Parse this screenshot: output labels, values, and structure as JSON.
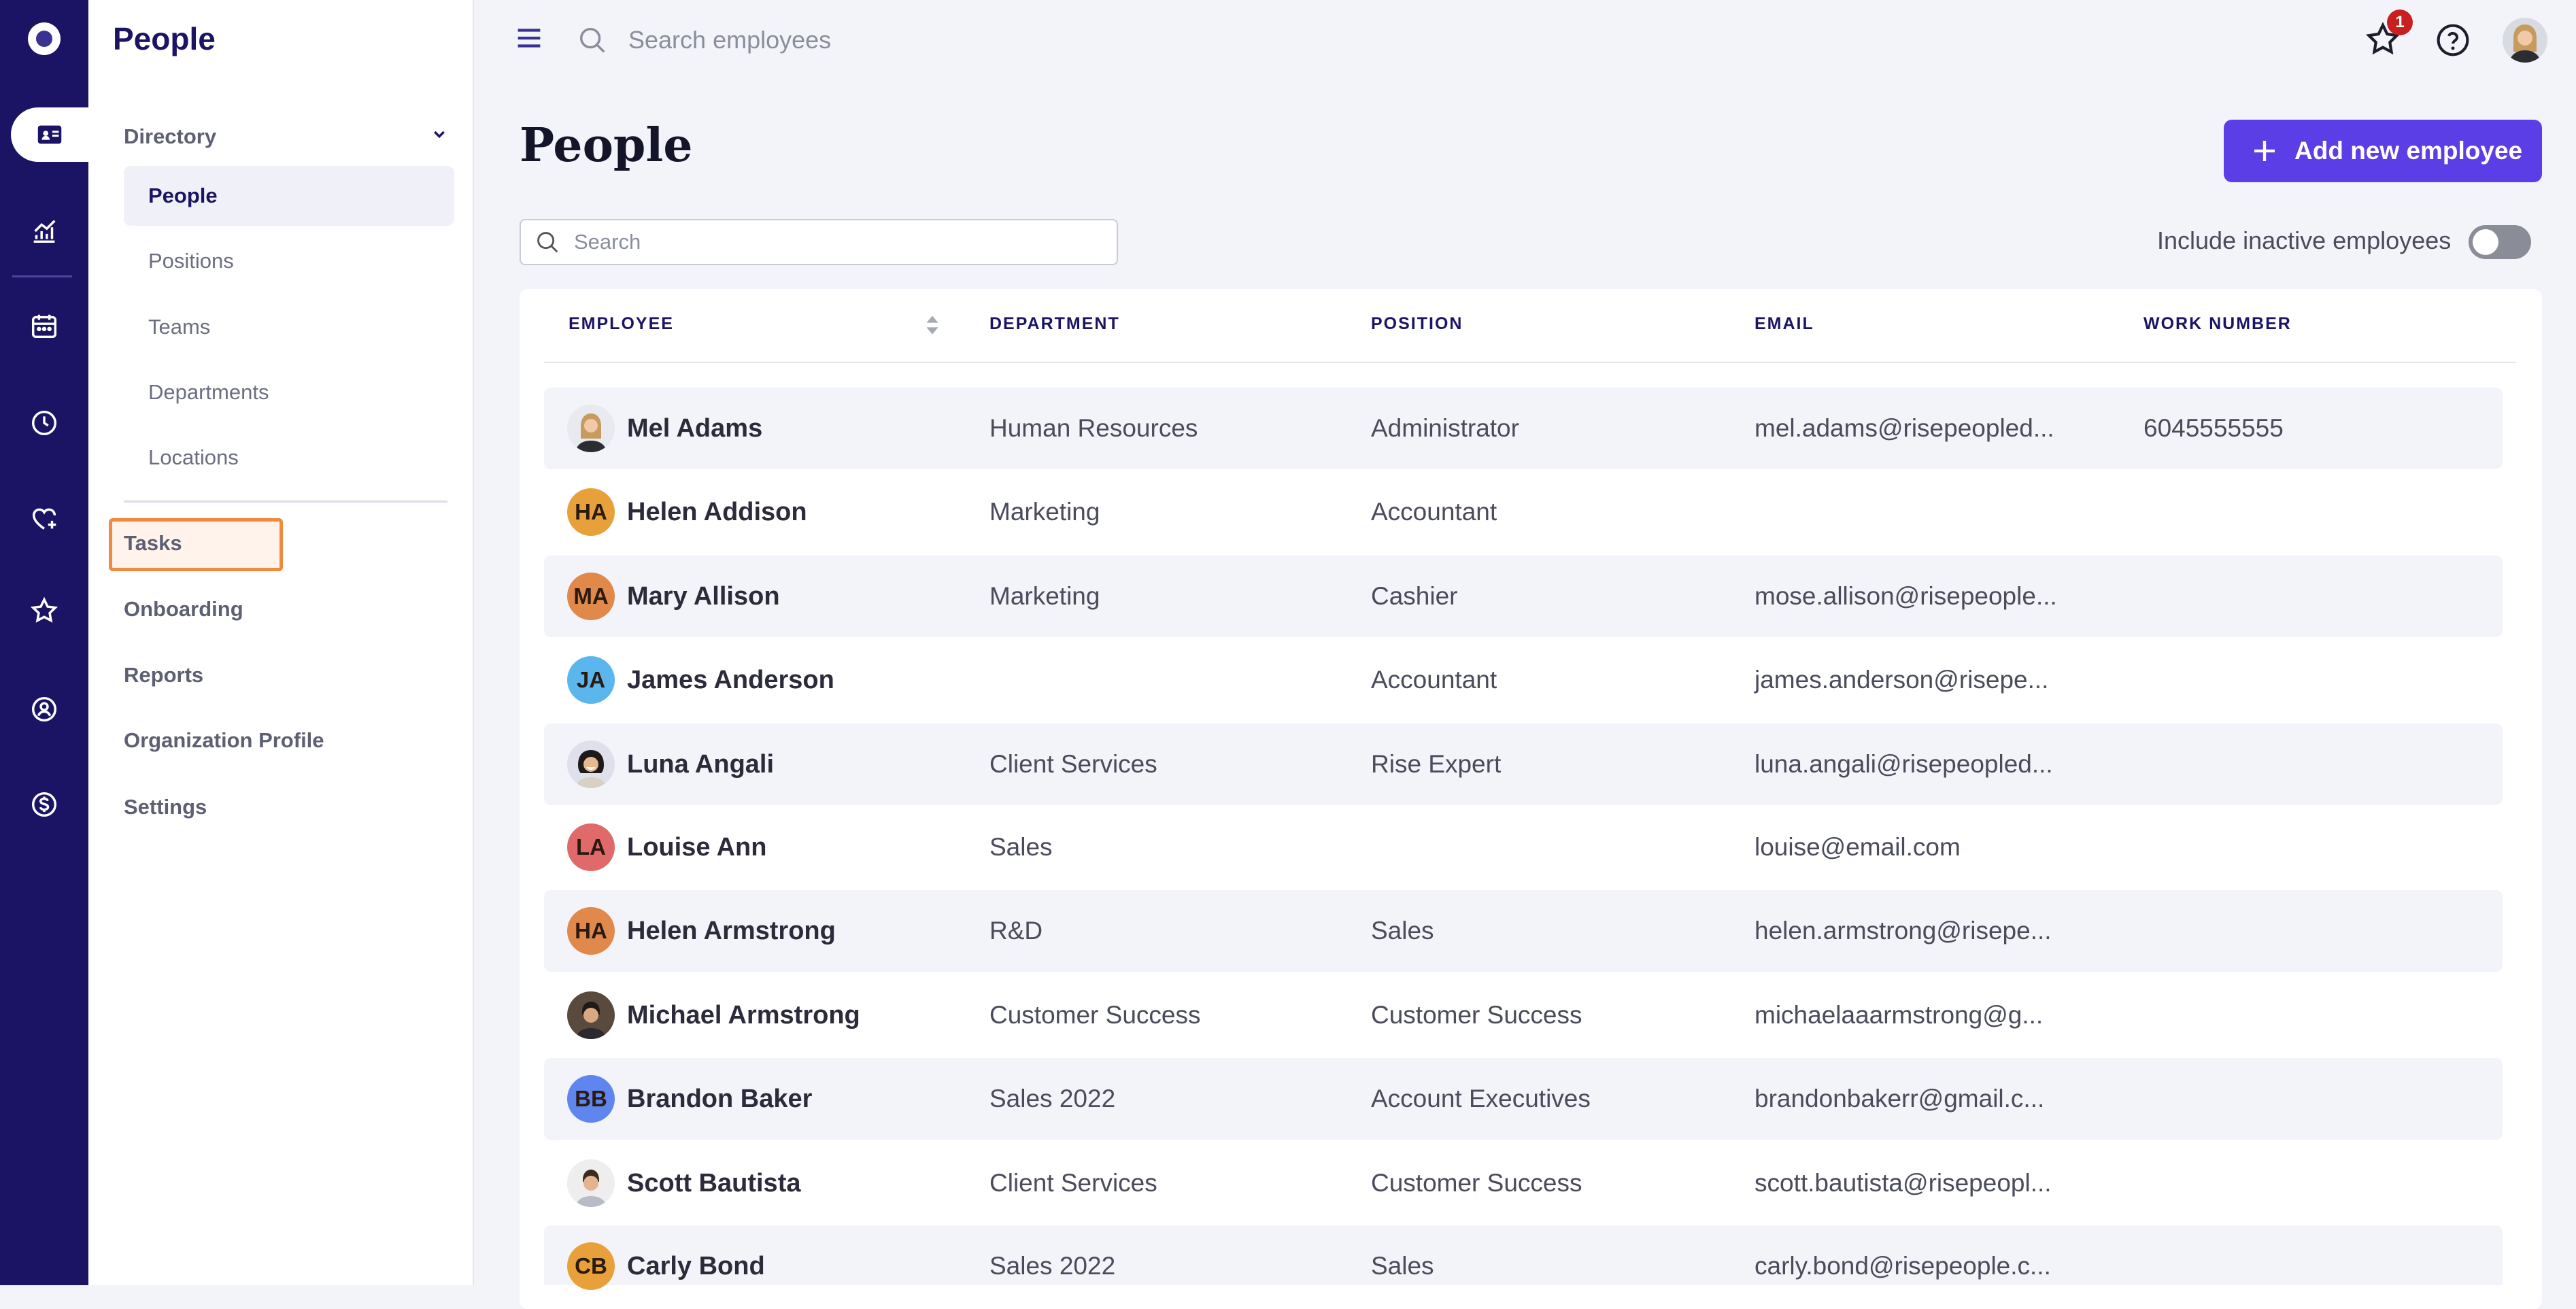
{
  "sidebar": {
    "title": "People",
    "directory_label": "Directory",
    "directory_items": [
      {
        "label": "People",
        "active": true
      },
      {
        "label": "Positions"
      },
      {
        "label": "Teams"
      },
      {
        "label": "Departments"
      },
      {
        "label": "Locations"
      }
    ],
    "items": [
      {
        "label": "Tasks",
        "highlighted": true
      },
      {
        "label": "Onboarding"
      },
      {
        "label": "Reports"
      },
      {
        "label": "Organization Profile"
      },
      {
        "label": "Settings"
      }
    ]
  },
  "rail": {
    "icons": [
      "logo-icon",
      "people-card-icon",
      "analytics-icon",
      "calendar-icon",
      "clock-icon",
      "heart-plus-icon",
      "star-icon",
      "person-search-icon",
      "dollar-icon"
    ],
    "active": "people-card-icon"
  },
  "topbar": {
    "search_placeholder": "Search employees",
    "notification_count": "1"
  },
  "main": {
    "title": "People",
    "add_button_label": "Add new employee",
    "search_placeholder": "Search",
    "include_inactive_label": "Include inactive employees",
    "include_inactive": false
  },
  "table": {
    "columns": [
      "EMPLOYEE",
      "DEPARTMENT",
      "POSITION",
      "EMAIL",
      "WORK NUMBER"
    ],
    "rows": [
      {
        "initials": "",
        "photo": "woman-photo",
        "name": "Mel Adams",
        "department": "Human Resources",
        "position": "Administrator",
        "email": "mel.adams@risepeopled...",
        "work": "6045555555"
      },
      {
        "initials": "HA",
        "color": "#e8a13a",
        "name": "Helen Addison",
        "department": "Marketing",
        "position": "Accountant",
        "email": "",
        "work": ""
      },
      {
        "initials": "MA",
        "color": "#e0894a",
        "name": "Mary Allison",
        "department": "Marketing",
        "position": "Cashier",
        "email": "mose.allison@risepeople...",
        "work": ""
      },
      {
        "initials": "JA",
        "color": "#5cb6ee",
        "name": "James Anderson",
        "department": "",
        "position": "Accountant",
        "email": "james.anderson@risepe...",
        "work": ""
      },
      {
        "initials": "",
        "photo": "woman-photo",
        "name": "Luna Angali",
        "department": "Client Services",
        "position": "Rise Expert",
        "email": "luna.angali@risepeopled...",
        "work": ""
      },
      {
        "initials": "LA",
        "color": "#e06a6a",
        "name": "Louise Ann",
        "department": "Sales",
        "position": "",
        "email": "louise@email.com",
        "work": ""
      },
      {
        "initials": "HA",
        "color": "#e0894a",
        "name": "Helen Armstrong",
        "department": "R&D",
        "position": "Sales",
        "email": "helen.armstrong@risepe...",
        "work": ""
      },
      {
        "initials": "",
        "photo": "man-photo",
        "name": "Michael Armstrong",
        "department": "Customer Success",
        "position": "Customer Success",
        "email": "michaelaaarmstrong@g...",
        "work": ""
      },
      {
        "initials": "BB",
        "color": "#5f86ee",
        "name": "Brandon Baker",
        "department": "Sales 2022",
        "position": "Account Executives",
        "email": "brandonbakerr@gmail.c...",
        "work": ""
      },
      {
        "initials": "",
        "photo": "man-photo",
        "name": "Scott Bautista",
        "department": "Client Services",
        "position": "Customer Success",
        "email": "scott.bautista@risepeopl...",
        "work": ""
      },
      {
        "initials": "CB",
        "color": "#e8a13a",
        "name": "Carly Bond",
        "department": "Sales 2022",
        "position": "Sales",
        "email": "carly.bond@risepeople.c...",
        "work": ""
      }
    ]
  },
  "colors": {
    "rail": "#1b1464",
    "accent": "#5b3ee6",
    "highlight_border": "#f08a3c",
    "badge": "#c81f1f"
  }
}
